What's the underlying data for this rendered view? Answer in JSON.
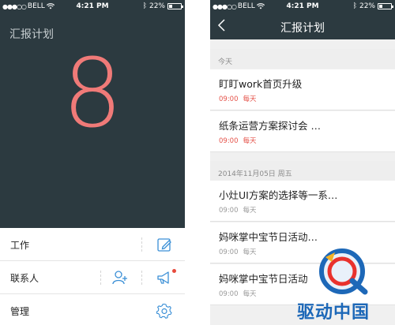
{
  "status_bar": {
    "carrier": "BELL",
    "time": "4:21 PM",
    "battery": "22%"
  },
  "left": {
    "title": "汇报计划",
    "big_number": "8",
    "menu": [
      {
        "label": "工作"
      },
      {
        "label": "联系人"
      },
      {
        "label": "管理"
      }
    ]
  },
  "right": {
    "title": "汇报计划",
    "sections": [
      {
        "header": "今天",
        "items": [
          {
            "title": "盯盯work首页升级",
            "time": "09:00",
            "repeat": "每天"
          },
          {
            "title": "纸条运营方案探讨会 …",
            "time": "09:00",
            "repeat": "每天"
          }
        ]
      },
      {
        "header": "2014年11月05日  周五",
        "items": [
          {
            "title": "小灶UI方案的选择等一系…",
            "time": "09:00",
            "repeat": "每天"
          },
          {
            "title": "妈咪掌中宝节日活动…",
            "time": "09:00",
            "repeat": "每天"
          },
          {
            "title": "妈咪掌中宝节日活动",
            "time": "09:00",
            "repeat": "每天"
          }
        ]
      }
    ]
  },
  "watermark": {
    "text": "驱动中国"
  },
  "colors": {
    "dark_bg": "#2c3a40",
    "accent_red": "#f07a78",
    "time_red": "#e5544b",
    "icon_blue": "#3a8fd6"
  }
}
